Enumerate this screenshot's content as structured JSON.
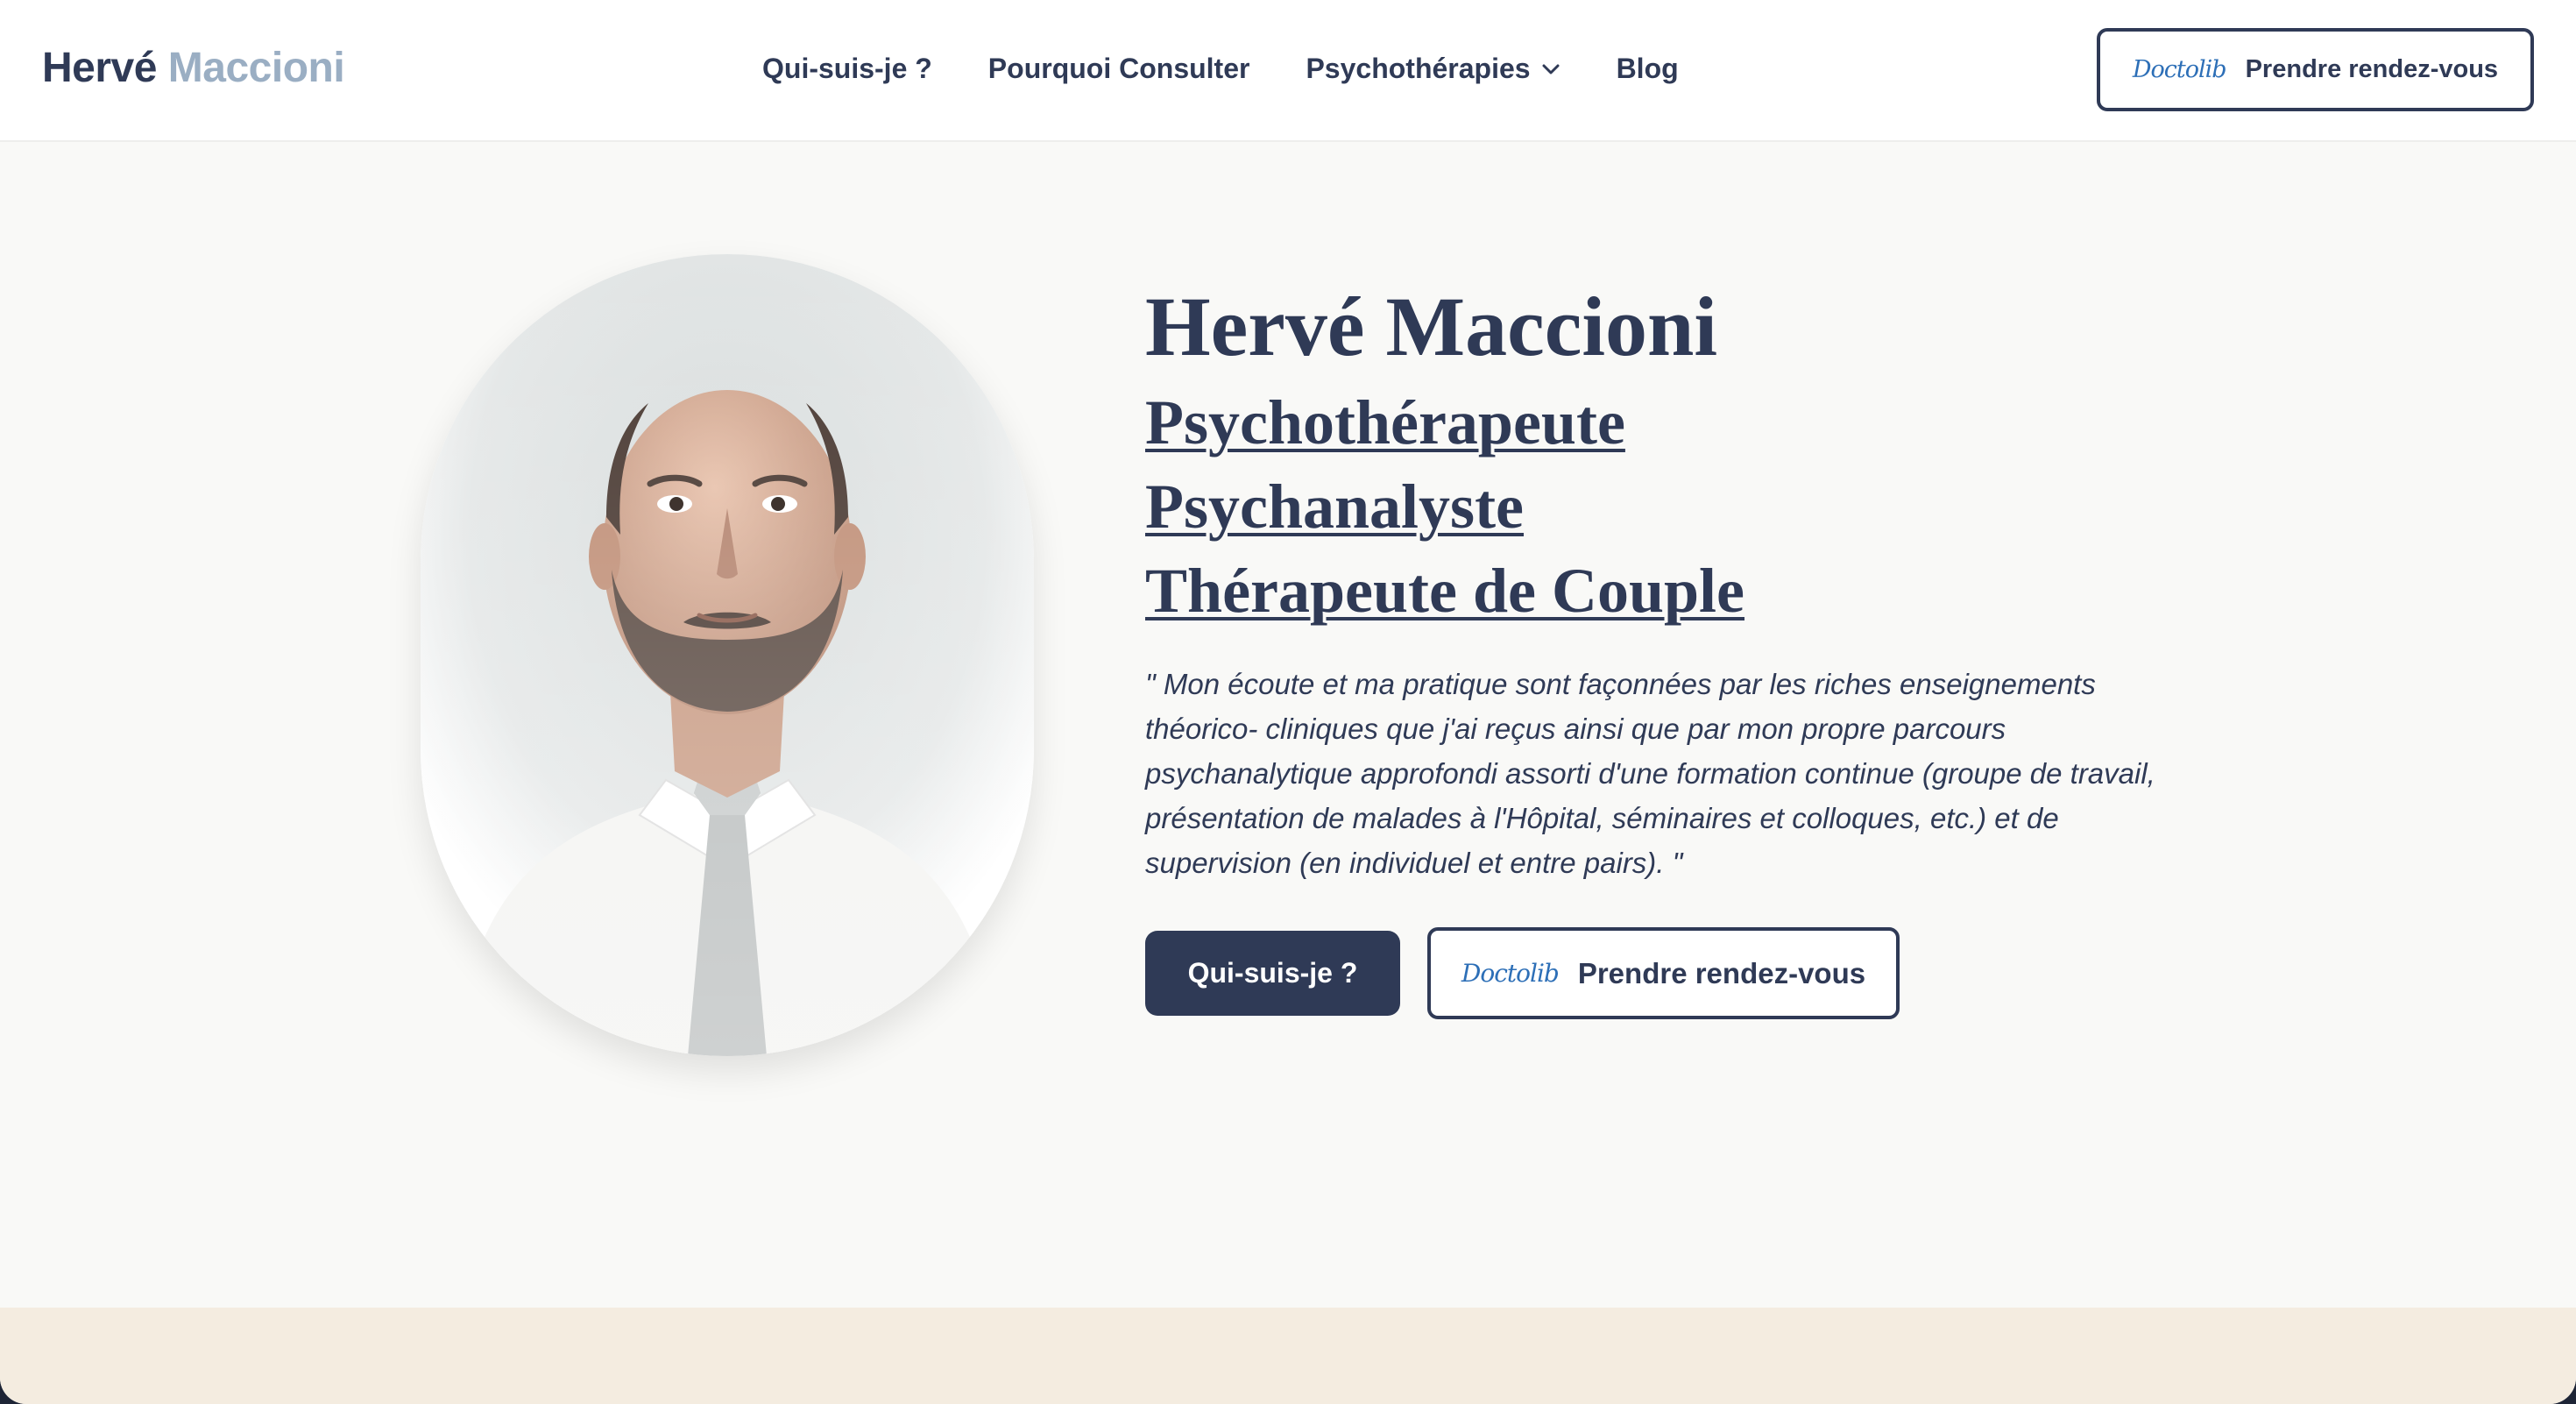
{
  "header": {
    "brand_first": "Hervé",
    "brand_last": "Maccioni",
    "nav": [
      {
        "label": "Qui-suis-je ?"
      },
      {
        "label": "Pourquoi Consulter"
      },
      {
        "label": "Psychothérapies",
        "icon": "chevron-down-icon"
      },
      {
        "label": "Blog"
      }
    ],
    "cta": {
      "logo": "Doctolib",
      "label": "Prendre rendez-vous"
    }
  },
  "hero": {
    "name": "Hervé Maccioni",
    "titles": [
      "Psychothérapeute",
      "Psychanalyste",
      "Thérapeute de Couple"
    ],
    "quote": "\" Mon écoute et ma pratique sont façonnées par les riches enseignements théorico- cliniques que j'ai reçus ainsi que par mon propre parcours psychanalytique approfondi assorti d'une formation continue (groupe de travail, présentation de malades à l'Hôpital, séminaires et colloques, etc.) et de supervision (en individuel et entre pairs). \"",
    "primary_button": "Qui-suis-je ?",
    "secondary_button": {
      "logo": "Doctolib",
      "label": "Prendre rendez-vous"
    }
  },
  "colors": {
    "navy": "#2f3a56",
    "brand_light": "#9aaec3",
    "doctolib_blue": "#2d6fb7",
    "hero_bg": "#f9f9f7",
    "next_section_bg": "#f4ece0"
  }
}
